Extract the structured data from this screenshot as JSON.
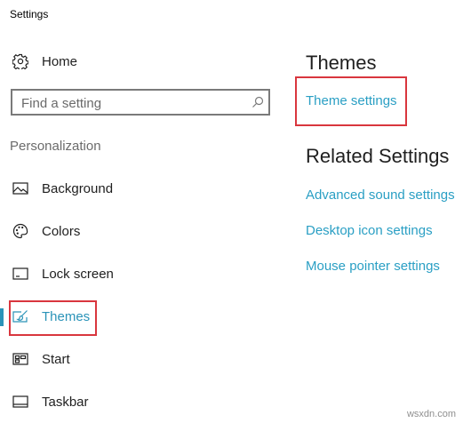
{
  "window": {
    "title": "Settings"
  },
  "nav": {
    "home_label": "Home",
    "search": {
      "placeholder": "Find a setting",
      "value": ""
    },
    "section_label": "Personalization",
    "items": [
      {
        "label": "Background",
        "icon": "image-icon",
        "selected": false
      },
      {
        "label": "Colors",
        "icon": "palette-icon",
        "selected": false
      },
      {
        "label": "Lock screen",
        "icon": "lock-screen-icon",
        "selected": false
      },
      {
        "label": "Themes",
        "icon": "themes-brush-icon",
        "selected": true
      },
      {
        "label": "Start",
        "icon": "start-icon",
        "selected": false
      },
      {
        "label": "Taskbar",
        "icon": "taskbar-icon",
        "selected": false
      }
    ]
  },
  "main": {
    "themes_heading": "Themes",
    "theme_settings_link": "Theme settings",
    "related_heading": "Related Settings",
    "related_links": [
      "Advanced sound settings",
      "Desktop icon settings",
      "Mouse pointer settings"
    ]
  },
  "watermark": "wsxdn.com",
  "colors": {
    "accent": "#2a93b8",
    "link": "#2a9fc4",
    "highlight_box": "#d9363e",
    "text": "#1f1f1f",
    "muted": "#6b6b6b"
  }
}
